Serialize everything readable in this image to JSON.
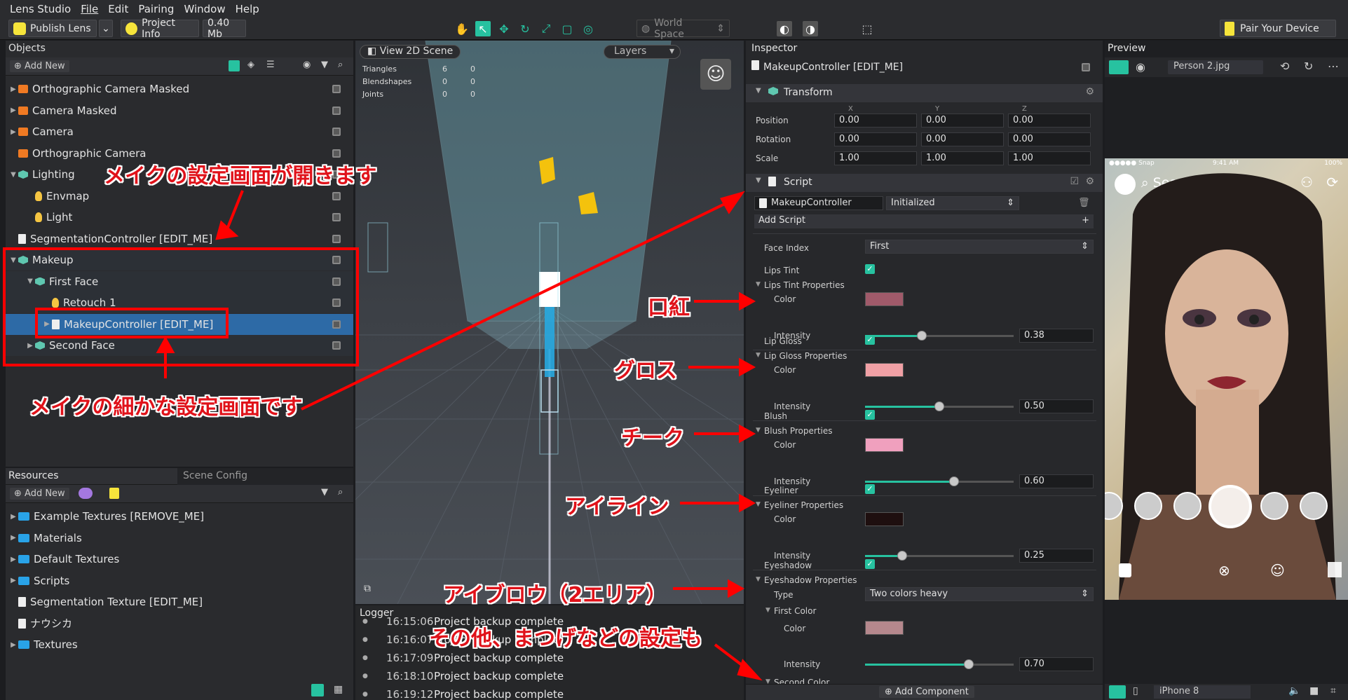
{
  "menu": {
    "app": "Lens Studio",
    "items": [
      "File",
      "Edit",
      "Pairing",
      "Window",
      "Help"
    ]
  },
  "toolbar": {
    "publish": "Publish Lens",
    "project_info": "Project Info",
    "size": "0.40 Mb",
    "world_space": "World Space",
    "pair": "Pair Your Device"
  },
  "objects": {
    "title": "Objects",
    "add_new": "Add New",
    "items": [
      {
        "label": "Orthographic Camera Masked",
        "icon": "camera-icon",
        "depth": 0,
        "arrow": "▶"
      },
      {
        "label": "Camera Masked",
        "icon": "camera-icon",
        "depth": 0,
        "arrow": "▶"
      },
      {
        "label": "Camera",
        "icon": "camera-icon",
        "depth": 0,
        "arrow": "▶"
      },
      {
        "label": "Orthographic Camera",
        "icon": "camera-icon",
        "depth": 0,
        "arrow": ""
      },
      {
        "label": "Lighting",
        "icon": "object-icon",
        "depth": 0,
        "arrow": "▼"
      },
      {
        "label": "Envmap",
        "icon": "bulb-icon",
        "depth": 1,
        "arrow": ""
      },
      {
        "label": "Light",
        "icon": "bulb-icon",
        "depth": 1,
        "arrow": ""
      },
      {
        "label": "SegmentationController [EDIT_ME]",
        "icon": "script-icon",
        "depth": 0,
        "arrow": ""
      },
      {
        "label": "Makeup",
        "icon": "object-icon",
        "depth": 0,
        "arrow": "▼"
      },
      {
        "label": "First Face",
        "icon": "object-icon",
        "depth": 1,
        "arrow": "▼"
      },
      {
        "label": "Retouch 1",
        "icon": "retouch-icon",
        "depth": 2,
        "arrow": ""
      },
      {
        "label": "MakeupController [EDIT_ME]",
        "icon": "script-icon",
        "depth": 2,
        "arrow": "▶"
      },
      {
        "label": "Second Face",
        "icon": "object-icon",
        "depth": 1,
        "arrow": "▶"
      }
    ]
  },
  "resources": {
    "tab1": "Resources",
    "tab2": "Scene Config",
    "add_new": "Add New",
    "items": [
      {
        "label": "Example Textures [REMOVE_ME]",
        "icon": "folder-icon",
        "arrow": "▶"
      },
      {
        "label": "Materials",
        "icon": "folder-icon",
        "arrow": "▶"
      },
      {
        "label": "Default Textures",
        "icon": "folder-icon",
        "arrow": "▶"
      },
      {
        "label": "Scripts",
        "icon": "folder-icon",
        "arrow": "▶"
      },
      {
        "label": "Segmentation Texture [EDIT_ME]",
        "icon": "texture-icon",
        "arrow": ""
      },
      {
        "label": "ナウシカ",
        "icon": "image-icon",
        "arrow": ""
      },
      {
        "label": "Textures",
        "icon": "folder-icon",
        "arrow": "▶"
      }
    ]
  },
  "scene": {
    "view2d": "View 2D Scene",
    "layers": "Layers",
    "stats": [
      {
        "k": "Triangles",
        "a": "6",
        "b": "0"
      },
      {
        "k": "Blendshapes",
        "a": "0",
        "b": "0"
      },
      {
        "k": "Joints",
        "a": "0",
        "b": "0"
      }
    ]
  },
  "logger": {
    "title": "Logger",
    "entries": [
      {
        "time": "16:15:06",
        "msg": "Project backup complete"
      },
      {
        "time": "16:16:07",
        "msg": "Project backup complete"
      },
      {
        "time": "16:17:09",
        "msg": "Project backup complete"
      },
      {
        "time": "16:18:10",
        "msg": "Project backup complete"
      },
      {
        "time": "16:19:12",
        "msg": "Project backup complete"
      }
    ]
  },
  "inspector": {
    "title": "Inspector",
    "object": "MakeupController [EDIT_ME]",
    "transform": {
      "title": "Transform",
      "axes": [
        "X",
        "Y",
        "Z"
      ],
      "rows": [
        {
          "label": "Position",
          "v": [
            "0.00",
            "0.00",
            "0.00"
          ]
        },
        {
          "label": "Rotation",
          "v": [
            "0.00",
            "0.00",
            "0.00"
          ]
        },
        {
          "label": "Scale",
          "v": [
            "1.00",
            "1.00",
            "1.00"
          ]
        }
      ]
    },
    "script": {
      "title": "Script",
      "name": "MakeupController",
      "state": "Initialized",
      "add_script": "Add Script"
    },
    "face_index": {
      "label": "Face Index",
      "value": "First"
    },
    "lips_tint": {
      "label": "Lips Tint",
      "props": "Lips Tint Properties",
      "color": "#a05a6a",
      "intensity": 0.38,
      "intensity_text": "0.38"
    },
    "lip_gloss": {
      "label": "Lip Gloss",
      "props": "Lip Gloss Properties",
      "color": "#f0a0a5",
      "intensity": 0.5,
      "intensity_text": "0.50"
    },
    "blush": {
      "label": "Blush",
      "props": "Blush Properties",
      "color": "#f0a0be",
      "intensity": 0.6,
      "intensity_text": "0.60"
    },
    "eyeliner": {
      "label": "Eyeliner",
      "props": "Eyeliner Properties",
      "color": "#1e0f0f",
      "intensity": 0.25,
      "intensity_text": "0.25"
    },
    "eyeshadow": {
      "label": "Eyeshadow",
      "props": "Eyeshadow Properties",
      "type_label": "Type",
      "type_value": "Two colors heavy",
      "first_color": "First Color",
      "color": "#b5888d",
      "intensity": 0.7,
      "intensity_text": "0.70",
      "second_color": "Second Color"
    },
    "labels": {
      "color": "Color",
      "intensity": "Intensity"
    },
    "add_component": "Add Component"
  },
  "preview": {
    "title": "Preview",
    "image": "Person 2.jpg",
    "device": "iPhone 8",
    "search": "Search",
    "time": "9:41 AM",
    "battery": "100%",
    "carrier": "●●●●● Snap"
  },
  "annotations": {
    "a1": "メイクの設定画面が開きます",
    "a2": "メイクの細かな設定画面です",
    "a3": "口紅",
    "a4": "グロス",
    "a5": "チーク",
    "a6": "アイライン",
    "a7": "アイブロウ（2エリア）",
    "a8": "その他、まつげなどの設定も"
  }
}
